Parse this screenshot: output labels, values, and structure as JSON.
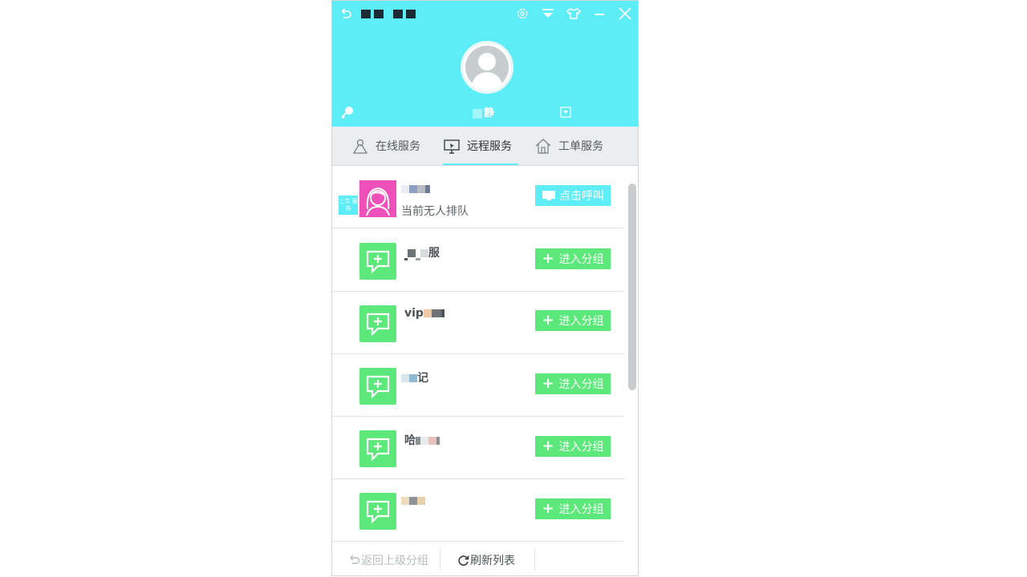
{
  "window": {
    "title_masked": "",
    "colors": {
      "header_bg": "#5dedf6",
      "accent_green": "#5ce87a",
      "agent_pink": "#ef4fb9"
    }
  },
  "titlebar": {
    "icons": [
      "back-icon",
      "settings-icon",
      "dropdown-icon",
      "skin-icon",
      "minimize-icon",
      "close-icon"
    ]
  },
  "user": {
    "name_visible": "静"
  },
  "tabs": [
    {
      "label": "在线服务",
      "icon": "person-icon",
      "active": false
    },
    {
      "label": "远程服务",
      "icon": "remote-screen-icon",
      "active": true
    },
    {
      "label": "工单服务",
      "icon": "house-icon",
      "active": false
    }
  ],
  "agent": {
    "badge": "上次 服务",
    "name_visible": "",
    "status": "当前无人排队",
    "call_button": "点击呼叫"
  },
  "groups": [
    {
      "name_visible": "服",
      "button": "进入分组"
    },
    {
      "name_visible": "vip",
      "button": "进入分组"
    },
    {
      "name_visible": "记",
      "button": "进入分组"
    },
    {
      "name_visible": "哈",
      "button": "进入分组"
    },
    {
      "name_visible": "",
      "button": "进入分组"
    }
  ],
  "footer": {
    "back_label": "返回上级分组",
    "refresh_label": "刷新列表"
  }
}
